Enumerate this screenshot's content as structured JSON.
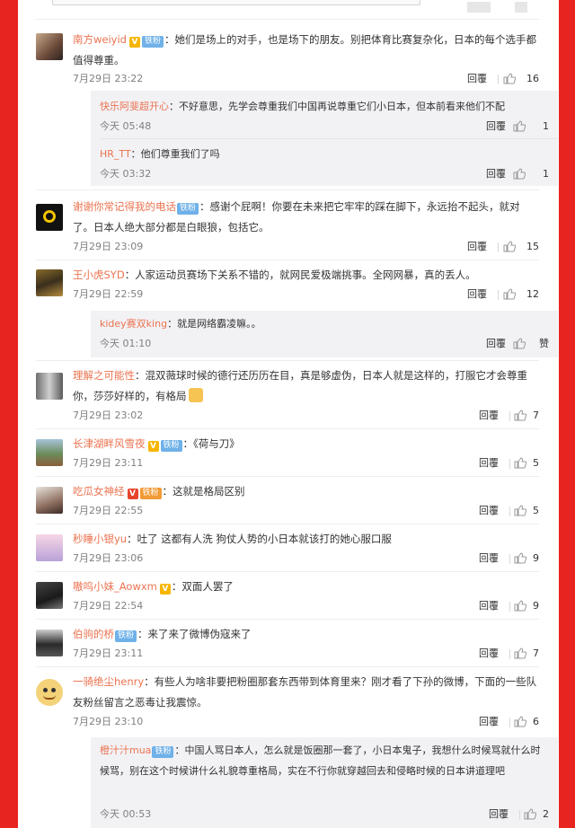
{
  "ui": {
    "reply_label": "回覆",
    "fan_badge": "铁粉"
  },
  "comments": [
    {
      "name": "南方weiyid",
      "text": "：她们是场上的对手，也是场下的朋友。别把体育比赛复杂化，日本的每个选手都值得尊重。",
      "time": "7月29日 23:22",
      "likes": "16",
      "replies": [
        {
          "name": "快乐阿斐超开心",
          "text": "：不好意思，先学会尊重我们中国再说尊重它们小日本，但本前看来他们不配",
          "time": "今天 05:48",
          "likes": "1"
        },
        {
          "name": "HR_TT",
          "text": "：他们尊重我们了吗",
          "time": "今天 03:32",
          "likes": "1"
        }
      ]
    },
    {
      "name": "谢谢你常记得我的电话",
      "text": "：感谢个屁啊！你要在未来把它牢牢的踩在脚下，永远抬不起头，就对了。日本人绝大部分都是白眼狼，包括它。",
      "time": "7月29日 23:09",
      "likes": "15"
    },
    {
      "name": "王小虎SYD",
      "text": "：人家运动员赛场下关系不错的，就网民爱极端挑事。全网网暴，真的丢人。",
      "time": "7月29日 22:59",
      "likes": "12",
      "replies": [
        {
          "name": "kidey赛双king",
          "text": "：就是网络霸凌嘛。。",
          "time": "今天 01:10",
          "likes": "赞"
        }
      ]
    },
    {
      "name": "理解之可能性",
      "text": "：混双薇球时候的德行还历历在目，真是够虚伪，日本人就是这样的，打服它才会尊重你，莎莎好样的，有格局",
      "time": "7月29日 23:02",
      "likes": "7"
    },
    {
      "name": "长津湖畔风雪夜",
      "text": "：《荷与刀》",
      "time": "7月29日 23:11",
      "likes": "5"
    },
    {
      "name": "吃瓜女神经",
      "text": "：这就是格局区别",
      "time": "7月29日 22:55",
      "likes": "5"
    },
    {
      "name": "秒睡小银yu",
      "text": "：吐了 这都有人洗 狗仗人势的小日本就该打的她心服口服",
      "time": "7月29日 23:06",
      "likes": "9"
    },
    {
      "name": "嗷呜小妹_Aowxm",
      "text": "：双面人罢了",
      "time": "7月29日 22:54",
      "likes": "9"
    },
    {
      "name": "伯驹的桥",
      "text": "：来了来了微博伪寇来了",
      "time": "7月29日 23:11",
      "likes": "7"
    },
    {
      "name": "一骑绝尘henry",
      "text": "：有些人为啥非要把粉圈那套东西带到体育里来？刚才看了下孙的微博，下面的一些队友粉丝留言之恶毒让我震惊。",
      "time": "7月29日 23:10",
      "likes": "6",
      "replies": [
        {
          "name": "橙汁汁mua",
          "text": "：中国人骂日本人，怎么就是饭圈那一套了，小日本鬼子，我想什么时候骂就什么时候骂，别在这个时候讲什么礼貌尊重格局，实在不行你就穿越回去和侵略时候的日本讲道理吧",
          "time": "今天 00:53",
          "likes": "2"
        }
      ]
    }
  ],
  "colors": {
    "background_red": "#e82420",
    "username": "#eb7350",
    "fan_badge": "#6fb1e8",
    "reply_bg": "#f2f2f5"
  }
}
